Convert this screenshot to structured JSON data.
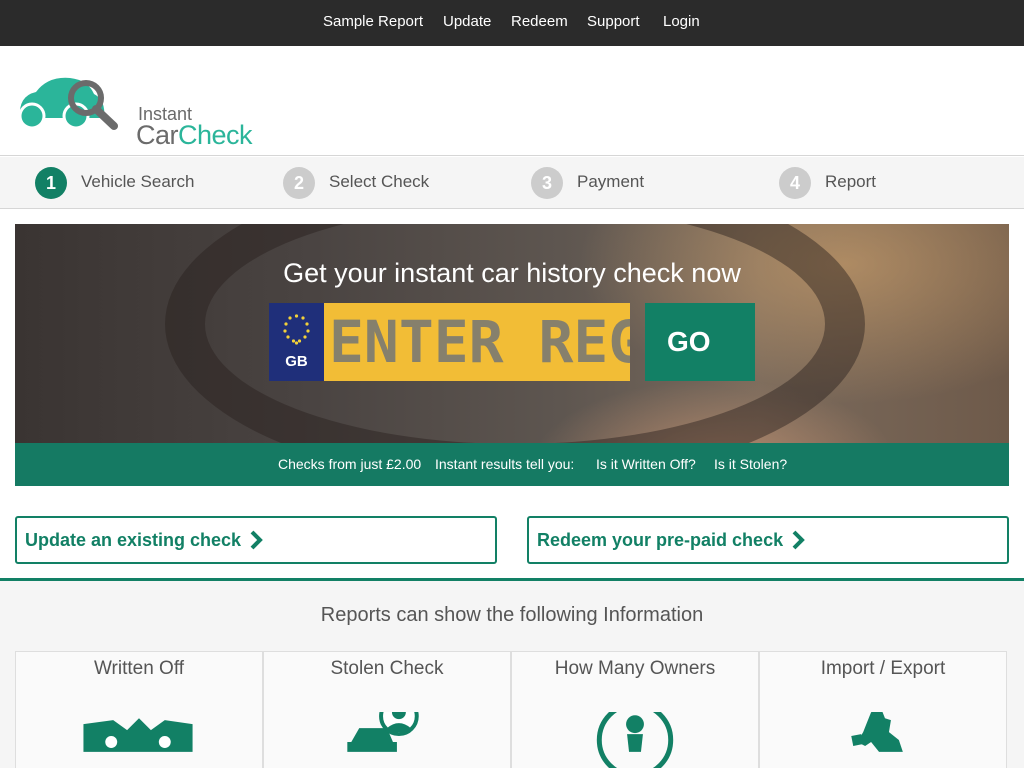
{
  "nav": {
    "items": [
      {
        "label": "Sample Report"
      },
      {
        "label": "Update"
      },
      {
        "label": "Redeem"
      },
      {
        "label": "Support"
      },
      {
        "label": "Login"
      }
    ]
  },
  "logo": {
    "line1": "Instant",
    "line2_a": "Car",
    "line2_b": "Check",
    "icon": "car-magnifier-logo",
    "colors": {
      "brand_green": "#2bb59a",
      "text_grey": "#6b6b6b"
    }
  },
  "steps": [
    {
      "num": "1",
      "label": "Vehicle Search",
      "active": true
    },
    {
      "num": "2",
      "label": "Select Check",
      "active": false
    },
    {
      "num": "3",
      "label": "Payment",
      "active": false
    },
    {
      "num": "4",
      "label": "Report",
      "active": false
    }
  ],
  "hero": {
    "title": "Get your instant car history check now",
    "plate_country": "GB",
    "plate_placeholder": "ENTER REG",
    "go_label": "GO"
  },
  "features_bar": {
    "items": [
      "Checks from just £2.00",
      "Instant results tell you:",
      "Is it Written Off?",
      "Is it Stolen?"
    ]
  },
  "actions": {
    "update_label": "Update an existing check",
    "redeem_label": "Redeem your pre-paid check",
    "icon": "chevron-right-icon"
  },
  "info": {
    "title": "Reports can show the following Information",
    "cards": [
      {
        "title": "Written Off",
        "icon": "crashed-car-icon"
      },
      {
        "title": "Stolen Check",
        "icon": "thief-car-icon"
      },
      {
        "title": "How Many Owners",
        "icon": "owner-person-icon"
      },
      {
        "title": "Import / Export",
        "icon": "uk-map-icon"
      }
    ]
  },
  "colors": {
    "nav_bg": "#2b2b2b",
    "accent": "#128065",
    "plate_yellow": "#f2bd36",
    "plate_blue": "#1f2f7a"
  }
}
